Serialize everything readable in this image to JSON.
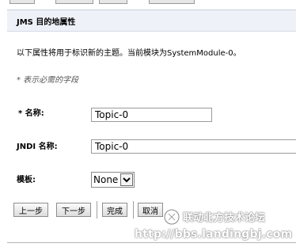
{
  "section": {
    "title": "JMS 目的地属性",
    "description": "以下属性将用于标识新的主题。当前模块为SystemModule-0。",
    "required_note": "* 表示必需的字段"
  },
  "fields": {
    "name": {
      "label": "* 名称:",
      "value": "Topic-0"
    },
    "jndi": {
      "label": "JNDI 名称:",
      "value": "Topic-0"
    },
    "template": {
      "label": "模板:",
      "selected": "None"
    }
  },
  "buttons": {
    "back": "上一步",
    "next": "下一步",
    "finish": "完成",
    "cancel": "取消"
  },
  "watermark": {
    "text": "联动北方技术论坛",
    "url": "http://bbs.landingbj.com"
  },
  "colors": {
    "header_bg": "#eef1f7",
    "input_border": "#9b9b9b"
  },
  "icons": {
    "dropdown": "chevron-down-icon",
    "watermark_logo": "logo-icon"
  }
}
